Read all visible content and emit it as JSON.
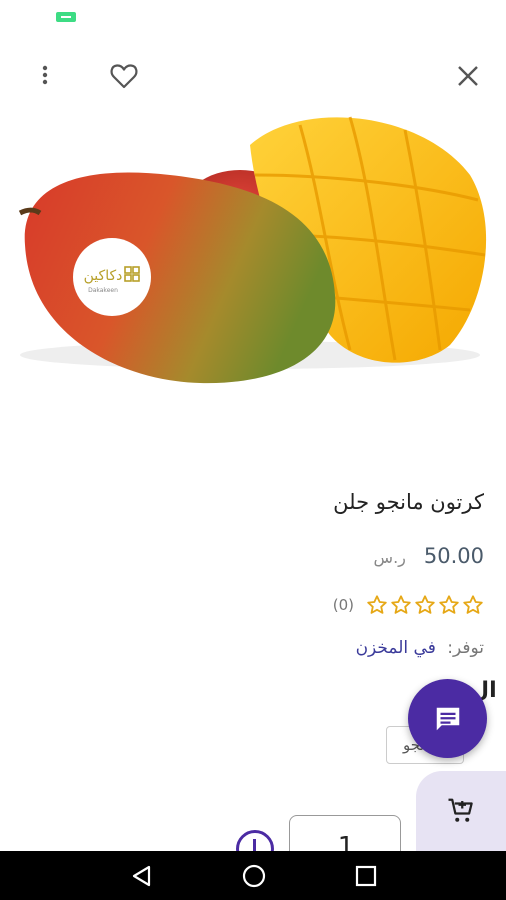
{
  "product": {
    "title": "كرتون مانجو جلن",
    "price": "50.00",
    "currency": "ر.س",
    "rating": 0,
    "rating_max": 5,
    "review_count": "(0)",
    "availability_label": "توفر:",
    "availability_value": "في المخزن",
    "image_logo_text": "دكاكين",
    "image_logo_subtext": "Dakakeen"
  },
  "options": {
    "partial_heading": "ال",
    "chip_label": "مانجو"
  },
  "quantity": {
    "value": "1"
  },
  "icons": {
    "more": "more-vertical-icon",
    "favorite": "heart-outline-icon",
    "close": "close-icon",
    "chat": "chat-icon",
    "cart": "add-to-cart-icon",
    "plus": "plus-circle-icon"
  },
  "colors": {
    "accent": "#4b2ba3",
    "star": "#e6a817",
    "availability": "#3a3a9a",
    "cart_panel": "#e7e3f3"
  }
}
